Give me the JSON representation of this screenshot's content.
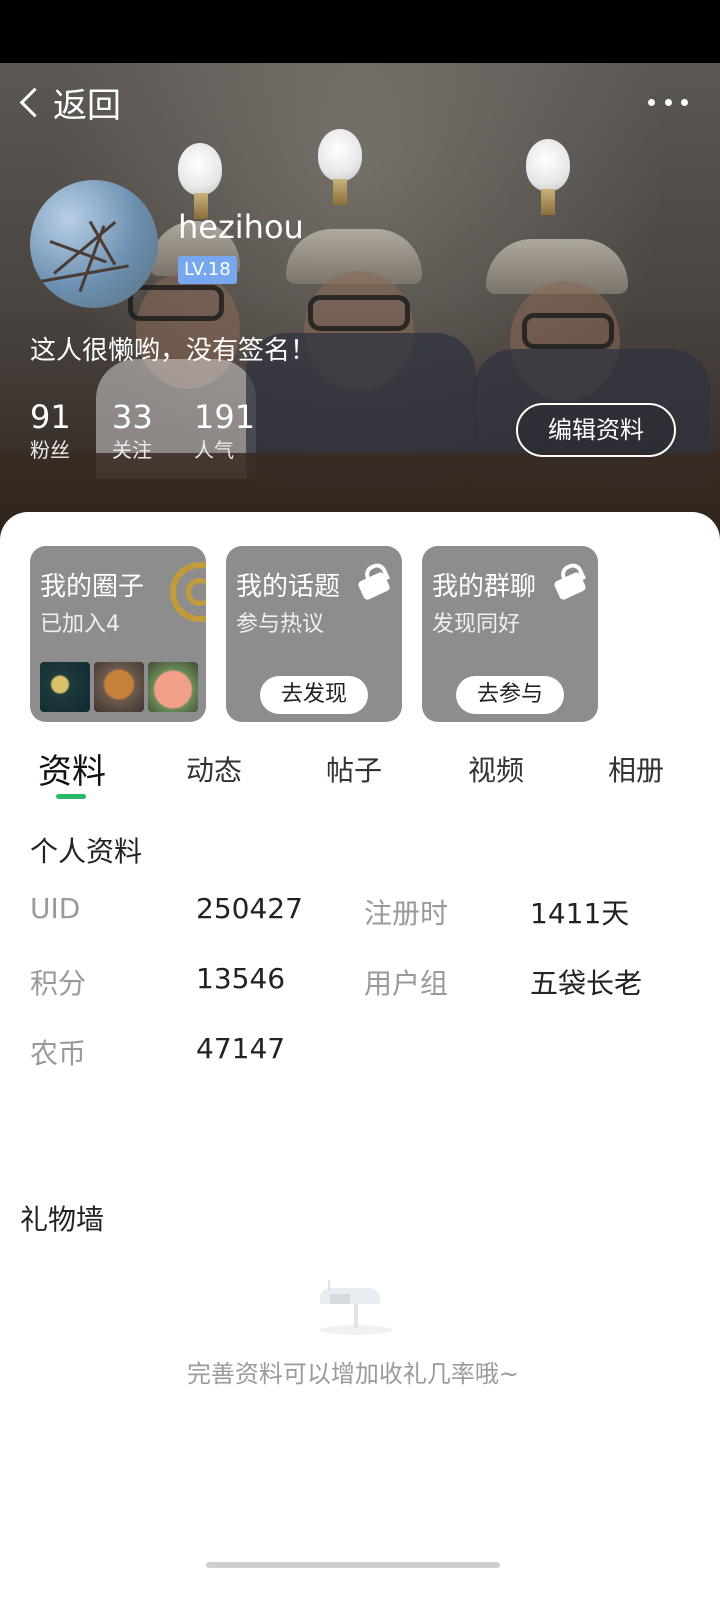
{
  "header": {
    "back_label": "返回",
    "username": "hezihou",
    "level": "LV.18",
    "signature": "这人很懒哟，没有签名！",
    "stats": [
      {
        "value": "91",
        "label": "粉丝"
      },
      {
        "value": "33",
        "label": "关注"
      },
      {
        "value": "191",
        "label": "人气"
      }
    ],
    "edit_label": "编辑资料"
  },
  "cards": [
    {
      "title": "我的圈子",
      "subtitle": "已加入4",
      "action": ""
    },
    {
      "title": "我的话题",
      "subtitle": "参与热议",
      "action": "去发现"
    },
    {
      "title": "我的群聊",
      "subtitle": "发现同好",
      "action": "去参与"
    }
  ],
  "tabs": [
    "资料",
    "动态",
    "帖子",
    "视频",
    "相册"
  ],
  "profile": {
    "title": "个人资料",
    "rows": [
      {
        "label1": "UID",
        "value1": "250427",
        "label2": "注册时",
        "value2": "1411天"
      },
      {
        "label1": "积分",
        "value1": "13546",
        "label2": "用户组",
        "value2": "五袋长老"
      },
      {
        "label1": "农币",
        "value1": "47147",
        "label2": "",
        "value2": ""
      }
    ]
  },
  "gift_wall": {
    "title": "礼物墙",
    "empty_text": "完善资料可以增加收礼几率哦~"
  },
  "colors": {
    "accent_green": "#2ab86a",
    "level_badge": "#76a7ef",
    "card_bg": "#8d8d8d"
  },
  "icons": [
    "back-chevron-icon",
    "more-icon",
    "lock-icon",
    "circle-logo-icon",
    "mailbox-icon"
  ]
}
